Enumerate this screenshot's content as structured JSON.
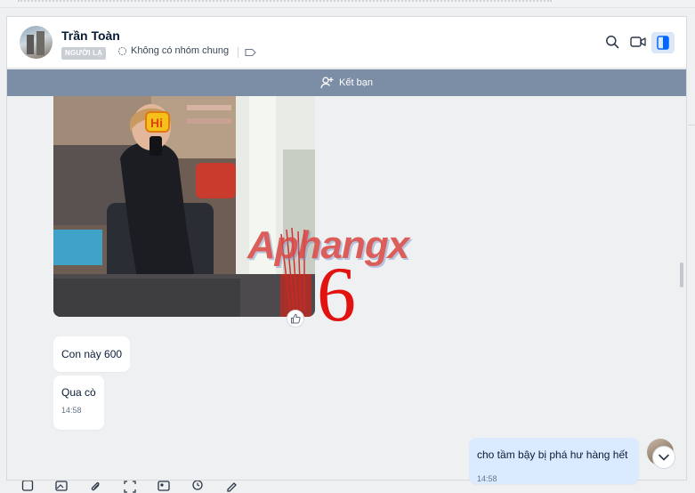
{
  "header": {
    "contact_name": "Trần Toàn",
    "relation_badge": "NGƯỜI LẠ",
    "group_status": "Không có nhóm chung"
  },
  "add_friend_bar": {
    "label": "Kết bạn"
  },
  "messages": [
    {
      "text": "Con này 600",
      "time": ""
    },
    {
      "text": "Qua cò",
      "time": "14:58"
    },
    {
      "text": "cho tầm bậy bị phá hư hàng hết",
      "time": "14:58"
    }
  ],
  "overlay": {
    "watermark": "Aphangx",
    "number": "6"
  },
  "icons": [
    "search-icon",
    "video-call-icon",
    "side-panel-icon",
    "tag-icon",
    "add-friend-icon",
    "thumbs-up-icon",
    "chevron-down-icon"
  ],
  "colors": {
    "add_bar": "#7c8ea6",
    "outgoing_bubble": "#dbebff",
    "accent": "#0068ff"
  }
}
